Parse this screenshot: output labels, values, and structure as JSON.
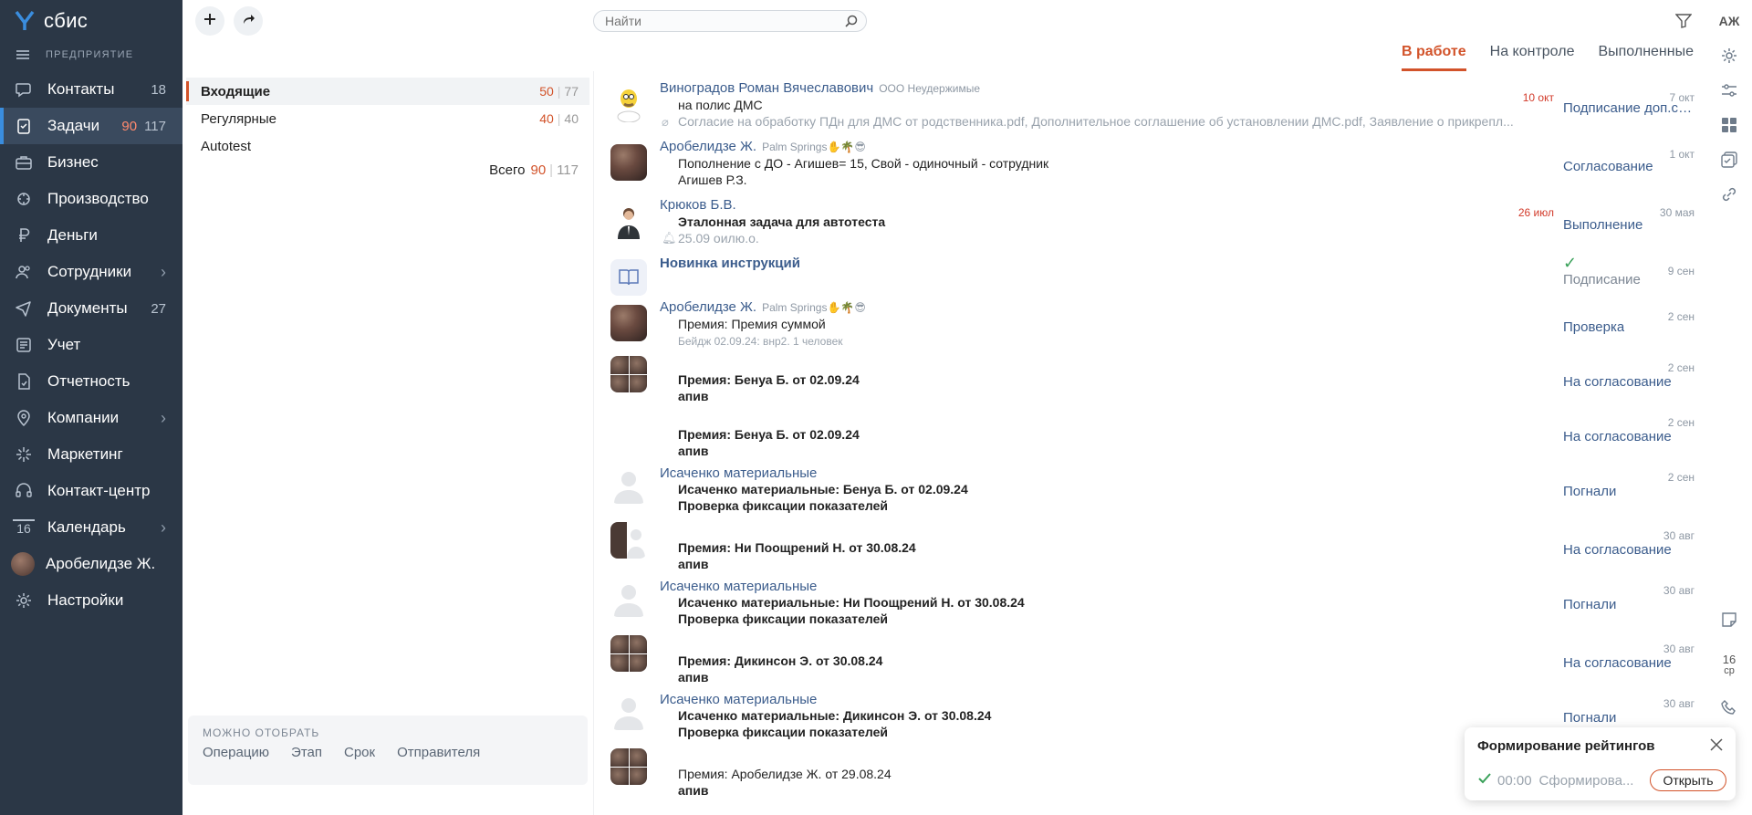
{
  "app": {
    "logo_text": "сбис",
    "section": "ПРЕДПРИЯТИЕ",
    "user_initials": "АЖ"
  },
  "nav": [
    {
      "label": "Контакты",
      "icon": "chat-icon",
      "count": "18"
    },
    {
      "label": "Задачи",
      "icon": "tasks-icon",
      "count_hot": "90",
      "count": "117",
      "active": true
    },
    {
      "label": "Бизнес",
      "icon": "briefcase-icon"
    },
    {
      "label": "Производство",
      "icon": "factory-icon"
    },
    {
      "label": "Деньги",
      "icon": "ruble-icon"
    },
    {
      "label": "Сотрудники",
      "icon": "people-icon",
      "chevron": true
    },
    {
      "label": "Документы",
      "icon": "paper-plane-icon",
      "count": "27"
    },
    {
      "label": "Учет",
      "icon": "ledger-icon"
    },
    {
      "label": "Отчетность",
      "icon": "report-icon"
    },
    {
      "label": "Компании",
      "icon": "location-icon",
      "chevron": true
    },
    {
      "label": "Маркетинг",
      "icon": "sparkle-icon"
    },
    {
      "label": "Контакт-центр",
      "icon": "headset-icon"
    },
    {
      "label": "Календарь",
      "icon": "calendar-icon",
      "day": "16",
      "chevron": true
    },
    {
      "label": "Аробелидзе Ж.",
      "icon": "avatar"
    },
    {
      "label": "Настройки",
      "icon": "gear-icon"
    }
  ],
  "folders": [
    {
      "label": "Входящие",
      "hot": "50",
      "all": "77",
      "active": true
    },
    {
      "label": "Регулярные",
      "hot": "40",
      "all": "40"
    },
    {
      "label": "Autotest"
    }
  ],
  "total": {
    "label": "Всего",
    "hot": "90",
    "all": "117"
  },
  "can_filter": {
    "title": "МОЖНО ОТОБРАТЬ",
    "options": [
      "Операцию",
      "Этап",
      "Срок",
      "Отправителя"
    ]
  },
  "search": {
    "placeholder": "Найти"
  },
  "tabs": [
    "В работе",
    "На контроле",
    "Выполненные"
  ],
  "tasks": [
    {
      "avatar": "homer",
      "who": "Виноградов Роман Вячеславович",
      "org": "ООО Неудержимые",
      "line1": "на полис ДМС",
      "muted": "Согласие на обработку ПДн для ДМС от родственника.pdf, Дополнительное соглашение об установлении ДМС.pdf, Заявление о прикрепл...",
      "deadline": "10 окт",
      "date": "7 окт",
      "status": "Подписание доп.со..."
    },
    {
      "avatar": "photo",
      "who": "Аробелидзе Ж.",
      "org": "Palm Springs✋🌴😎",
      "line1": "Пополнение с ДО - Агишев= 15, Свой - одиночный - сотрудник",
      "sub": "Агишев Р.З.",
      "date": "1 окт",
      "status": "Согласование"
    },
    {
      "avatar": "man",
      "who": "Крюков Б.В.",
      "line1": "Эталонная задача для автотеста",
      "muted": "25.09 оилю.о.",
      "deadline": "26 июл",
      "date": "30 мая",
      "status": "Выполнение"
    },
    {
      "avatar": "book",
      "who": "Новинка инструкций",
      "date": "9 сен",
      "status": "Подписание",
      "check": "✓"
    },
    {
      "avatar": "photo",
      "who": "Аробелидзе Ж.",
      "org": "Palm Springs✋🌴😎",
      "line1": "Премия: Премия суммой",
      "muted": "Бейдж 02.09.24: внр2. 1 человек",
      "date": "2 сен",
      "status": "Проверка"
    },
    {
      "avatar": "grid",
      "line1": "Премия: Бенуа Б. от 02.09.24",
      "sub": "апив",
      "date": "2 сен",
      "status": "На согласование"
    },
    {
      "avatar": "none",
      "line1": "Премия: Бенуа Б. от 02.09.24",
      "sub": "апив",
      "date": "2 сен",
      "status": "На согласование"
    },
    {
      "avatar": "ghost",
      "who": "Исаченко материальные",
      "line1": "Исаченко материальные: Бенуа Б. от 02.09.24",
      "sub": "Проверка фиксации показателей",
      "date": "2 сен",
      "status": "Погнали"
    },
    {
      "avatar": "half",
      "line1": "Премия: Ни Поощрений Н. от 30.08.24",
      "sub": "апив",
      "date": "30 авг",
      "status": "На согласование"
    },
    {
      "avatar": "ghost",
      "who": "Исаченко материальные",
      "line1": "Исаченко материальные: Ни Поощрений Н. от 30.08.24",
      "sub": "Проверка фиксации показателей",
      "date": "30 авг",
      "status": "Погнали"
    },
    {
      "avatar": "grid",
      "line1": "Премия: Дикинсон Э. от 30.08.24",
      "sub": "апив",
      "date": "30 авг",
      "status": "На согласование"
    },
    {
      "avatar": "ghost",
      "who": "Исаченко материальные",
      "line1": "Исаченко материальные: Дикинсон Э. от 30.08.24",
      "sub": "Проверка фиксации показателей",
      "date": "30 авг",
      "status": "Погнали"
    },
    {
      "avatar": "grid",
      "line1": "Премия: Аробелидзе Ж. от 29.08.24",
      "sub": "апив"
    }
  ],
  "toast": {
    "title": "Формирование рейтингов",
    "time": "00:00",
    "text": "Сформирова...",
    "button": "Открыть"
  },
  "rail": {
    "calendar_day": "16",
    "calendar_weekday": "ср"
  },
  "colors": {
    "nav_bg": "#2b3746",
    "accent": "#d2532a",
    "link": "#3b5c8c"
  }
}
